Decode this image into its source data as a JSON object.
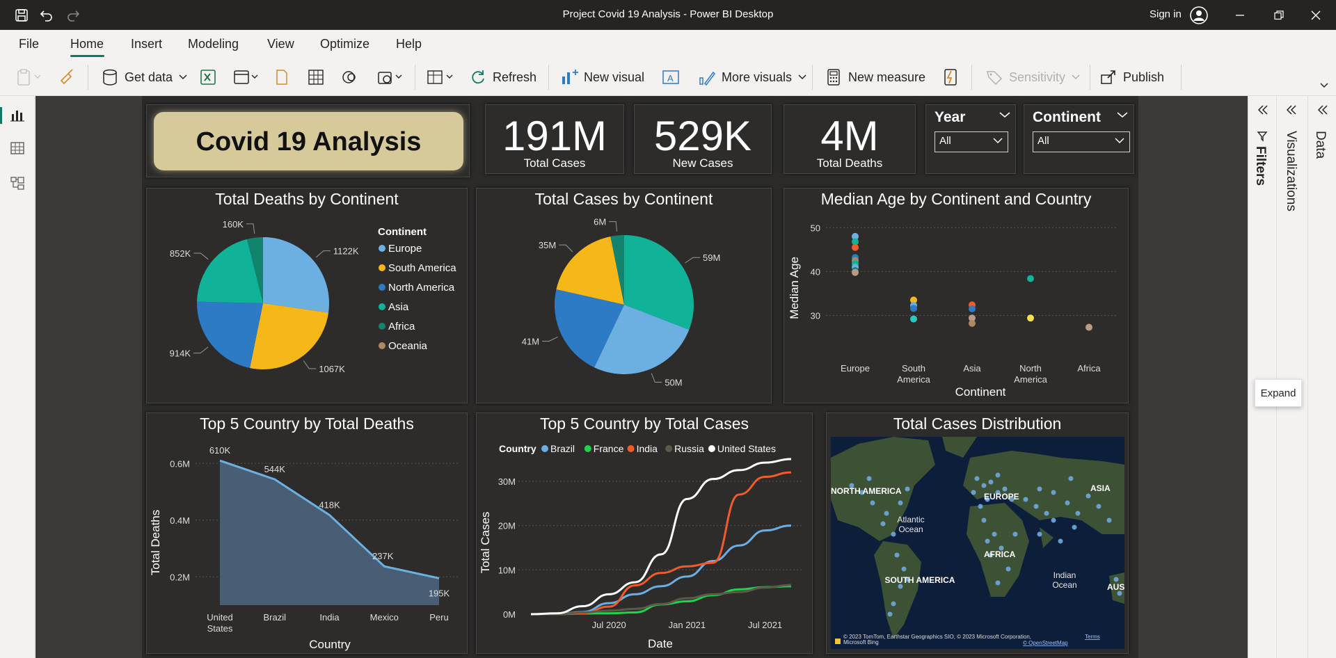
{
  "window": {
    "title": "Project Covid 19 Analysis - Power BI Desktop",
    "sign_in": "Sign in"
  },
  "menu": {
    "items": [
      "File",
      "Home",
      "Insert",
      "Modeling",
      "View",
      "Optimize",
      "Help"
    ],
    "active": "Home"
  },
  "toolbar": {
    "get_data": "Get data",
    "refresh": "Refresh",
    "new_visual": "New visual",
    "more_visuals": "More visuals",
    "new_measure": "New measure",
    "sensitivity": "Sensitivity",
    "publish": "Publish"
  },
  "report": {
    "title": "Covid 19 Analysis",
    "cards": [
      {
        "value": "191M",
        "label": "Total Cases"
      },
      {
        "value": "529K",
        "label": "New Cases"
      },
      {
        "value": "4M",
        "label": "Total Deaths"
      }
    ],
    "slicers": [
      {
        "title": "Year",
        "value": "All"
      },
      {
        "title": "Continent",
        "value": "All"
      }
    ],
    "visual_titles": {
      "deaths_by_continent": "Total Deaths by Continent",
      "cases_by_continent": "Total Cases by Continent",
      "median_age": "Median Age by Continent and Country",
      "top5_deaths": "Top 5 Country by Total Deaths",
      "top5_cases": "Top 5 Country by Total Cases",
      "cases_distribution": "Total Cases Distribution"
    },
    "map": {
      "labels": [
        "NORTH AMERICA",
        "EUROPE",
        "ASIA",
        "Atlantic Ocean",
        "AFRICA",
        "SOUTH AMERICA",
        "Indian Ocean",
        "AUS"
      ],
      "attribution": "© 2023 TomTom, Earthstar Geographics SIO, © 2023 Microsoft Corporation,",
      "terms": "Terms",
      "osm": "© OpenStreetMap",
      "bing": "Microsoft Bing"
    }
  },
  "colors": {
    "europe": "#6cb0e2",
    "south_america": "#f6b719",
    "north_america": "#2c7bc4",
    "asia": "#11b398",
    "africa": "#12836c",
    "oceania": "#ab8a63",
    "brazil": "#6aaee4",
    "france": "#1fd34f",
    "india": "#ef5b29",
    "russia": "#5c5a46",
    "united_states": "#ffffff"
  },
  "chart_data": [
    {
      "id": "deaths_by_continent",
      "type": "pie",
      "title": "Total Deaths by Continent",
      "legend_title": "Continent",
      "legend_position": "right",
      "categories": [
        "Europe",
        "South America",
        "North America",
        "Asia",
        "Africa",
        "Oceania"
      ],
      "values": [
        1122000,
        1067000,
        914000,
        852000,
        160000,
        0
      ],
      "data_labels": [
        "1122K",
        "1067K",
        "914K",
        "852K",
        "160K",
        ""
      ]
    },
    {
      "id": "cases_by_continent",
      "type": "pie",
      "title": "Total Cases by Continent",
      "categories": [
        "Asia",
        "Europe",
        "North America",
        "South America",
        "Africa"
      ],
      "values": [
        59000000,
        50000000,
        41000000,
        35000000,
        6000000
      ],
      "data_labels": [
        "59M",
        "50M",
        "41M",
        "35M",
        "6M"
      ]
    },
    {
      "id": "median_age",
      "type": "scatter",
      "title": "Median Age by Continent and Country",
      "xlabel": "Continent",
      "ylabel": "Median Age",
      "categories": [
        "Europe",
        "South America",
        "Asia",
        "North America",
        "Africa"
      ],
      "ylim": [
        22,
        51
      ],
      "yticks": [
        30,
        40,
        50
      ],
      "points": [
        {
          "x": "Europe",
          "y": 48,
          "color": "#6cb0e2"
        },
        {
          "x": "Europe",
          "y": 46.8,
          "color": "#11b398"
        },
        {
          "x": "Europe",
          "y": 45.5,
          "color": "#ef5b29"
        },
        {
          "x": "Europe",
          "y": 43.2,
          "color": "#2c7bc4"
        },
        {
          "x": "Europe",
          "y": 42.5,
          "color": "#ab8a63"
        },
        {
          "x": "Europe",
          "y": 41.8,
          "color": "#11b398"
        },
        {
          "x": "Europe",
          "y": 41,
          "color": "#6cb0e2"
        },
        {
          "x": "Europe",
          "y": 40.2,
          "color": "#12836c"
        },
        {
          "x": "Europe",
          "y": 39.8,
          "color": "#b99c83"
        },
        {
          "x": "South America",
          "y": 33.5,
          "color": "#f6b719"
        },
        {
          "x": "South America",
          "y": 32.3,
          "color": "#6cb0e2"
        },
        {
          "x": "South America",
          "y": 31.6,
          "color": "#2c7bc4"
        },
        {
          "x": "South America",
          "y": 29.2,
          "color": "#2dc6c0"
        },
        {
          "x": "Asia",
          "y": 32.4,
          "color": "#ef5b29"
        },
        {
          "x": "Asia",
          "y": 31.5,
          "color": "#2c7bc4"
        },
        {
          "x": "Asia",
          "y": 29.4,
          "color": "#b99c83"
        },
        {
          "x": "Asia",
          "y": 28.2,
          "color": "#ab8a63"
        },
        {
          "x": "North America",
          "y": 38.4,
          "color": "#11b398"
        },
        {
          "x": "North America",
          "y": 29.4,
          "color": "#f6e14a"
        },
        {
          "x": "Africa",
          "y": 27.3,
          "color": "#b99c83"
        }
      ]
    },
    {
      "id": "top5_deaths",
      "type": "area",
      "title": "Top 5 Country by Total Deaths",
      "xlabel": "Country",
      "ylabel": "Total Deaths",
      "categories": [
        "United States",
        "Brazil",
        "India",
        "Mexico",
        "Peru"
      ],
      "values": [
        610000,
        544000,
        418000,
        237000,
        195000
      ],
      "data_labels": [
        "610K",
        "544K",
        "418K",
        "237K",
        "195K"
      ],
      "yticks": [
        "0.2M",
        "0.4M",
        "0.6M"
      ],
      "ytick_values": [
        200000,
        400000,
        600000
      ],
      "ylim": [
        100000,
        640000
      ]
    },
    {
      "id": "top5_cases",
      "type": "line",
      "title": "Top 5 Country by Total Cases",
      "xlabel": "Date",
      "ylabel": "Total Cases",
      "legend_title": "Country",
      "legend_position": "top",
      "x": [
        "Jan 2020",
        "Mar 2020",
        "May 2020",
        "Jul 2020",
        "Sep 2020",
        "Nov 2020",
        "Jan 2021",
        "Mar 2021",
        "May 2021",
        "Jul 2021",
        "Aug 2021"
      ],
      "xticks": [
        "Jul 2020",
        "Jan 2021",
        "Jul 2021"
      ],
      "yticks": [
        "0M",
        "10M",
        "20M",
        "30M"
      ],
      "ylim": [
        0,
        35000000
      ],
      "series": [
        {
          "name": "Brazil",
          "color": "#6aaee4",
          "values": [
            0,
            0,
            500000,
            2500000,
            4500000,
            6300000,
            8500000,
            12000000,
            15500000,
            18900000,
            20000000
          ]
        },
        {
          "name": "France",
          "color": "#1fd34f",
          "values": [
            0,
            30000,
            150000,
            200000,
            400000,
            2200000,
            2900000,
            4300000,
            5600000,
            6100000,
            6300000
          ]
        },
        {
          "name": "India",
          "color": "#ef5b29",
          "values": [
            0,
            0,
            200000,
            1700000,
            6500000,
            9300000,
            10800000,
            11600000,
            27000000,
            31000000,
            32000000
          ]
        },
        {
          "name": "Russia",
          "color": "#5c5a46",
          "values": [
            0,
            0,
            400000,
            800000,
            1200000,
            2300000,
            3600000,
            4500000,
            5000000,
            6000000,
            6600000
          ]
        },
        {
          "name": "United States",
          "color": "#ffffff",
          "values": [
            0,
            200000,
            1800000,
            4500000,
            7200000,
            13500000,
            26000000,
            30500000,
            32500000,
            34200000,
            35000000
          ]
        }
      ]
    }
  ]
}
